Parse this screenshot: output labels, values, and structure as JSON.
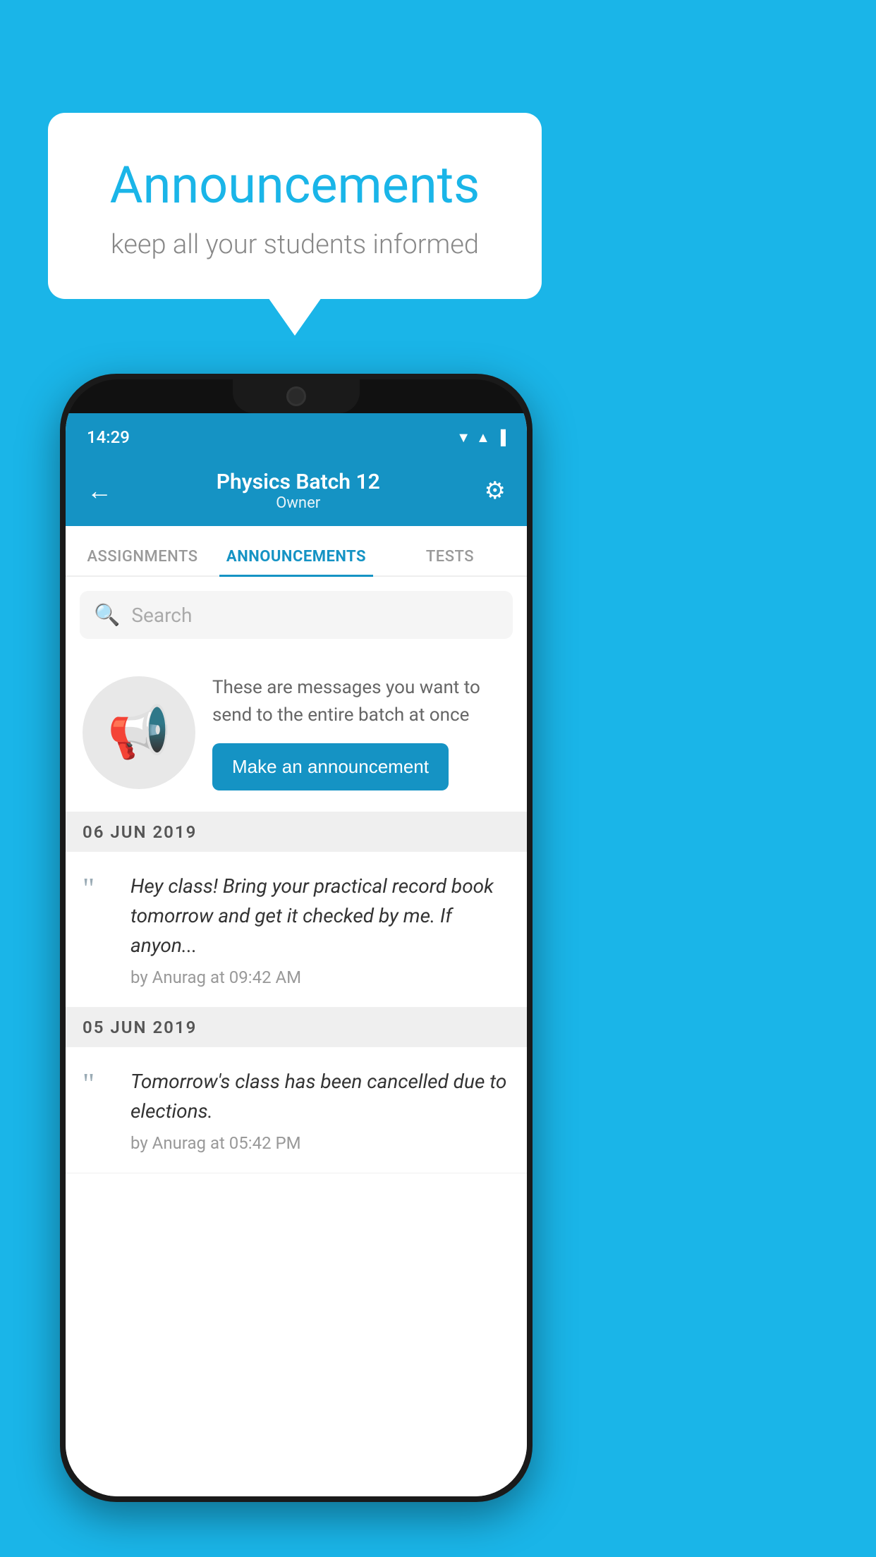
{
  "background_color": "#1ab5e8",
  "speech_bubble": {
    "title": "Announcements",
    "subtitle": "keep all your students informed"
  },
  "phone": {
    "status_bar": {
      "time": "14:29",
      "icons": "▼◀▐"
    },
    "app_bar": {
      "title": "Physics Batch 12",
      "subtitle": "Owner",
      "back_label": "←",
      "settings_label": "⚙"
    },
    "tabs": [
      {
        "label": "ASSIGNMENTS",
        "active": false
      },
      {
        "label": "ANNOUNCEMENTS",
        "active": true
      },
      {
        "label": "TESTS",
        "active": false
      }
    ],
    "search": {
      "placeholder": "Search"
    },
    "announcement_prompt": {
      "description": "These are messages you want to send to the entire batch at once",
      "button_label": "Make an announcement"
    },
    "announcements": [
      {
        "date": "06  JUN  2019",
        "text": "Hey class! Bring your practical record book tomorrow and get it checked by me. If anyon...",
        "meta": "by Anurag at 09:42 AM"
      },
      {
        "date": "05  JUN  2019",
        "text": "Tomorrow's class has been cancelled due to elections.",
        "meta": "by Anurag at 05:42 PM"
      }
    ]
  }
}
